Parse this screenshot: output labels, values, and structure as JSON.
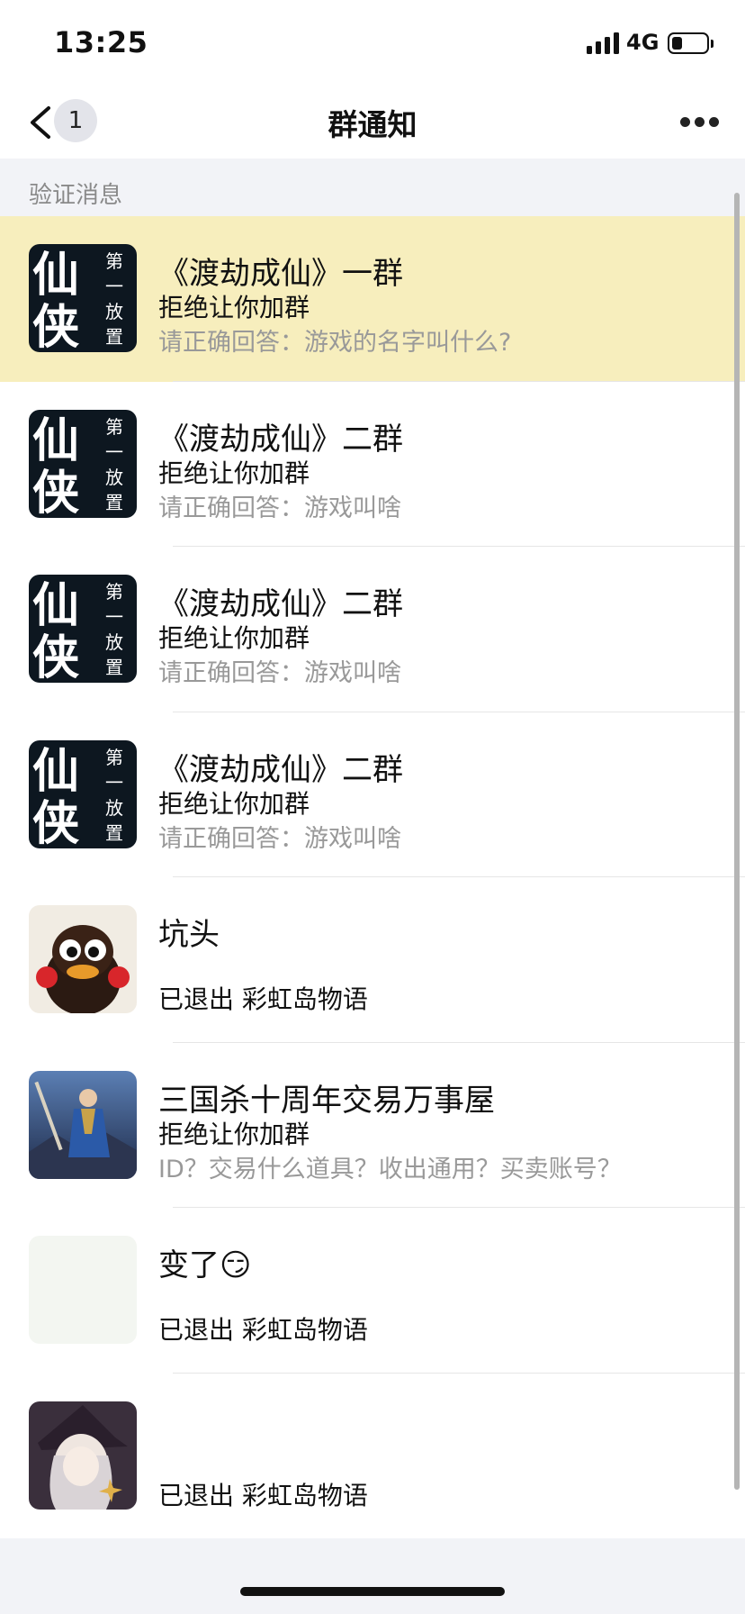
{
  "status_bar": {
    "time": "13:25",
    "network": "4G",
    "battery_level": 0.3
  },
  "nav": {
    "title": "群通知",
    "back_badge": "1"
  },
  "section": {
    "title": "验证消息"
  },
  "notifications": [
    {
      "name": "《渡劫成仙》一群",
      "status": "拒绝让你加群",
      "detail": "请正确回答：游戏的名字叫什么?",
      "avatar": "xianxia-game-icon",
      "highlighted": true
    },
    {
      "name": "《渡劫成仙》二群",
      "status": "拒绝让你加群",
      "detail": "请正确回答：游戏叫啥",
      "avatar": "xianxia-game-icon"
    },
    {
      "name": "《渡劫成仙》二群",
      "status": "拒绝让你加群",
      "detail": "请正确回答：游戏叫啥",
      "avatar": "xianxia-game-icon"
    },
    {
      "name": "《渡劫成仙》二群",
      "status": "拒绝让你加群",
      "detail": "请正确回答：游戏叫啥",
      "avatar": "xianxia-game-icon"
    },
    {
      "name": "坑头",
      "status": "已退出 彩虹岛物语",
      "detail": "",
      "avatar": "bird-avatar"
    },
    {
      "name": "三国杀十周年交易万事屋",
      "status": "拒绝让你加群",
      "detail": "ID？交易什么道具？收出通用？买卖账号？",
      "avatar": "warrior-avatar"
    },
    {
      "name": "变了😏",
      "status": "已退出 彩虹岛物语",
      "detail": "",
      "avatar": "blank-avatar"
    },
    {
      "name": "",
      "status": "已退出 彩虹岛物语",
      "detail": "",
      "avatar": "witch-avatar"
    }
  ],
  "game_icon_text": {
    "big": [
      "仙",
      "侠"
    ],
    "small": [
      "第",
      "一",
      "放",
      "置"
    ]
  },
  "colors": {
    "highlight": "#f7eebd",
    "secondary_text": "#999999",
    "background": "#f2f3f7"
  }
}
